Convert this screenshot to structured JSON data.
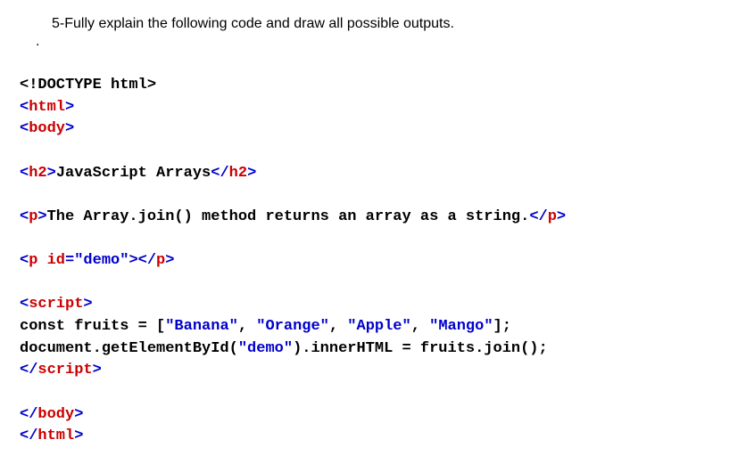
{
  "question": "5-Fully explain the following code and draw all possible outputs.",
  "dot": ".",
  "code": {
    "l1a": "<!DOCTYPE html>",
    "l2a": "<",
    "l2b": "html",
    "l2c": ">",
    "l3a": "<",
    "l3b": "body",
    "l3c": ">",
    "l4": "",
    "l5a": "<",
    "l5b": "h2",
    "l5c": ">",
    "l5d": "JavaScript Arrays",
    "l5e": "</",
    "l5f": "h2",
    "l5g": ">",
    "l6": "",
    "l7a": "<",
    "l7b": "p",
    "l7c": ">",
    "l7d": "The Array.join() method returns an array as a string.",
    "l7e": "</",
    "l7f": "p",
    "l7g": ">",
    "l8": "",
    "l9a": "<",
    "l9b": "p",
    "l9c": " ",
    "l9d": "id",
    "l9e": "=",
    "l9f": "\"demo\"",
    "l9g": "></",
    "l9h": "p",
    "l9i": ">",
    "l10": "",
    "l11a": "<",
    "l11b": "script",
    "l11c": ">",
    "l12a": "const fruits = [",
    "l12b": "\"Banana\"",
    "l12c": ", ",
    "l12d": "\"Orange\"",
    "l12e": ", ",
    "l12f": "\"Apple\"",
    "l12g": ", ",
    "l12h": "\"Mango\"",
    "l12i": "];",
    "l13a": "document.getElementById(",
    "l13b": "\"demo\"",
    "l13c": ").innerHTML = fruits.join();",
    "l14a": "</",
    "l14b": "script",
    "l14c": ">",
    "l15": "",
    "l16a": "</",
    "l16b": "body",
    "l16c": ">",
    "l17a": "</",
    "l17b": "html",
    "l17c": ">"
  }
}
